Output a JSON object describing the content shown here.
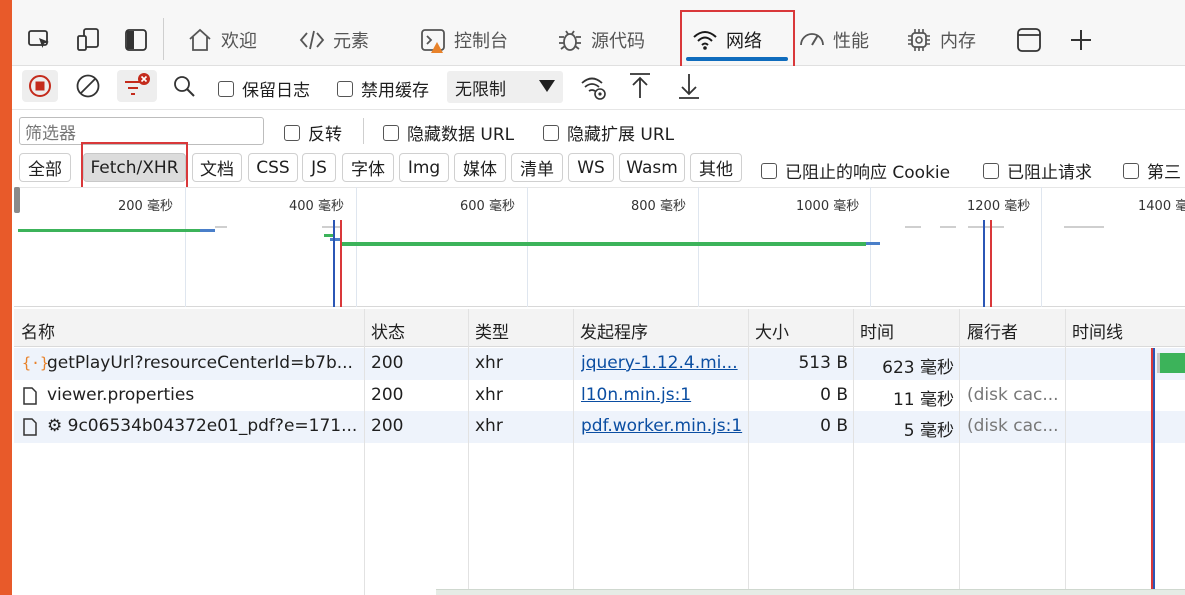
{
  "tabs": [
    {
      "label": "欢迎",
      "icon": "home-icon"
    },
    {
      "label": "元素",
      "icon": "code-brackets-icon"
    },
    {
      "label": "控制台",
      "icon": "console-icon"
    },
    {
      "label": "源代码",
      "icon": "bug-icon"
    },
    {
      "label": "网络",
      "icon": "wifi-icon"
    },
    {
      "label": "性能",
      "icon": "gauge-icon"
    },
    {
      "label": "内存",
      "icon": "chip-icon"
    }
  ],
  "toolbar": {
    "preserve_log": "保留日志",
    "disable_cache": "禁用缓存",
    "throttle": "无限制"
  },
  "filter": {
    "placeholder": "筛选器",
    "invert": "反转",
    "hide_data_url": "隐藏数据 URL",
    "hide_ext_url": "隐藏扩展 URL"
  },
  "types": [
    "全部",
    "Fetch/XHR",
    "文档",
    "CSS",
    "JS",
    "字体",
    "Img",
    "媒体",
    "清单",
    "WS",
    "Wasm",
    "其他"
  ],
  "blocked": {
    "cookies": "已阻止的响应 Cookie",
    "requests": "已阻止请求",
    "third": "第三"
  },
  "overview_ticks": [
    "200 毫秒",
    "400 毫秒",
    "600 毫秒",
    "800 毫秒",
    "1000 毫秒",
    "1200 毫秒",
    "1400 毫秒"
  ],
  "columns": [
    "名称",
    "状态",
    "类型",
    "发起程序",
    "大小",
    "时间",
    "履行者",
    "时间线"
  ],
  "rows": [
    {
      "name": "getPlayUrl?resourceCenterId=b7b...",
      "status": "200",
      "type": "xhr",
      "initiator": "jquery-1.12.4.mi...",
      "size": "513 B",
      "time": "623 毫秒",
      "fulfilled": ""
    },
    {
      "name": "viewer.properties",
      "status": "200",
      "type": "xhr",
      "initiator": "l10n.min.js:1",
      "size": "0 B",
      "time": "11 毫秒",
      "fulfilled": "(disk cac..."
    },
    {
      "name": "⚙ 9c06534b04372e01_pdf?e=171...",
      "status": "200",
      "type": "xhr",
      "initiator": "pdf.worker.min.js:1",
      "size": "0 B",
      "time": "5 毫秒",
      "fulfilled": "(disk cac..."
    }
  ]
}
